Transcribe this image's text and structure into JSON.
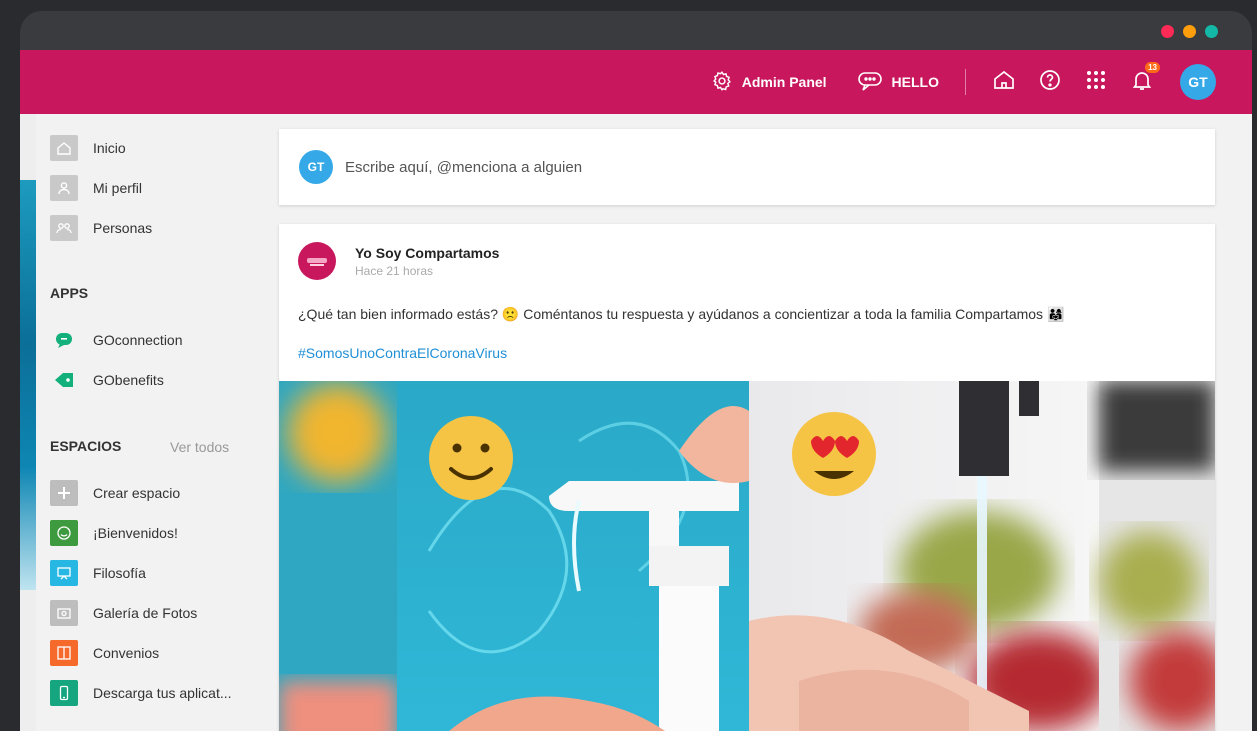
{
  "topbar": {
    "admin_label": "Admin Panel",
    "hello_label": "HELLO",
    "notifications_count": "13",
    "avatar_initials": "GT",
    "bg_color": "#c8175d"
  },
  "sidebar": {
    "nav": [
      {
        "label": "Inicio",
        "icon": "home-icon"
      },
      {
        "label": "Mi perfil",
        "icon": "user-icon"
      },
      {
        "label": "Personas",
        "icon": "people-icon"
      }
    ],
    "apps_title": "APPS",
    "apps": [
      {
        "label": "GOconnection",
        "icon": "chat-icon",
        "color": "#13b07b"
      },
      {
        "label": "GObenefits",
        "icon": "ticket-icon",
        "color": "#13b07b"
      }
    ],
    "spaces_title": "ESPACIOS",
    "spaces_see_all": "Ver todos",
    "spaces": [
      {
        "label": "Crear espacio",
        "icon": "plus-icon",
        "color": "#bdbdbd"
      },
      {
        "label": "¡Bienvenidos!",
        "icon": "smile-icon",
        "color": "#3e9a3e"
      },
      {
        "label": "Filosofía",
        "icon": "board-icon",
        "color": "#27b7e3"
      },
      {
        "label": "Galería de Fotos",
        "icon": "photo-icon",
        "color": "#bdbdbd"
      },
      {
        "label": "Convenios",
        "icon": "book-icon",
        "color": "#f5692a"
      },
      {
        "label": "Descarga tus aplicat...",
        "icon": "phone-icon",
        "color": "#15a57f"
      }
    ]
  },
  "composer": {
    "avatar_initials": "GT",
    "placeholder": "Escribe aquí, @menciona a alguien"
  },
  "post": {
    "author": "Yo Soy Compartamos",
    "time": "Hace 21 horas",
    "text": "¿Qué tan bien informado estás? 🙁 Coméntanos tu respuesta y ayúdanos a concientizar a toda la familia Compartamos 👨‍👩‍👧",
    "hashtag": "#SomosUnoContraElCoronaVirus"
  }
}
